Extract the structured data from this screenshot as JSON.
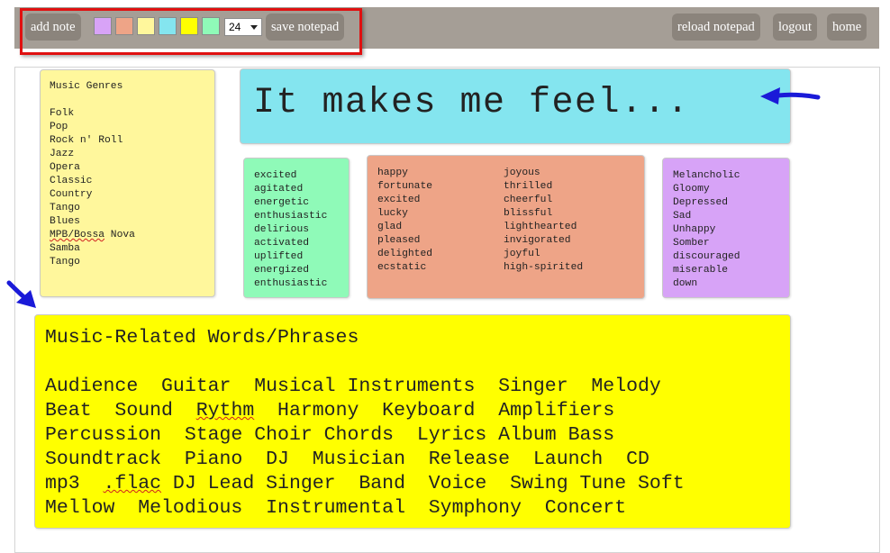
{
  "toolbar": {
    "add_note": "add note",
    "swatches": [
      "#d8a3f7",
      "#eea487",
      "#fff79c",
      "#84e5ef",
      "#ffff00",
      "#8ffab8"
    ],
    "font_size": "24",
    "save_notepad": "save notepad",
    "reload_notepad": "reload notepad",
    "logout": "logout",
    "home": "home"
  },
  "notes": {
    "genres": [
      "Music Genres",
      "",
      "Folk",
      "Pop",
      "Rock n' Roll",
      "Jazz",
      "Opera",
      "Classic",
      "Country",
      "Tango",
      "Blues",
      "MPB/Bossa Nova",
      "Samba",
      "Tango"
    ],
    "feel_title": "It makes me feel...",
    "green": [
      "excited",
      "agitated",
      "energetic",
      "enthusiastic",
      "delirious",
      "activated",
      "uplifted",
      "energized",
      "enthusiastic"
    ],
    "orange_col1": [
      "happy",
      "fortunate",
      "excited",
      "lucky",
      "glad",
      "pleased",
      "delighted",
      "ecstatic"
    ],
    "orange_col2": [
      "joyous",
      "thrilled",
      "cheerful",
      "blissful",
      "lighthearted",
      "invigorated",
      "joyful",
      "high-spirited"
    ],
    "purple": [
      "Melancholic",
      "Gloomy",
      "Depressed",
      "Sad",
      "Unhappy",
      "Somber",
      "discouraged",
      "miserable",
      "down"
    ],
    "music_title": "Music-Related Words/Phrases",
    "music_lines": [
      "Audience  Guitar  Musical Instruments  Singer  Melody",
      "Beat  Sound  Rythm  Harmony  Keyboard  Amplifiers",
      "Percussion  Stage Choir Chords  Lyrics Album Bass",
      "Soundtrack  Piano  DJ  Musician  Release  Launch  CD",
      "mp3  .flac DJ Lead Singer  Band  Voice  Swing Tune Soft",
      "Mellow  Melodious  Instrumental  Symphony  Concert"
    ]
  },
  "colors": {
    "toolbar_bg": "#a59e96",
    "button_bg": "#8b847c",
    "highlight": "#e01010",
    "arrow": "#1a1ad8"
  }
}
